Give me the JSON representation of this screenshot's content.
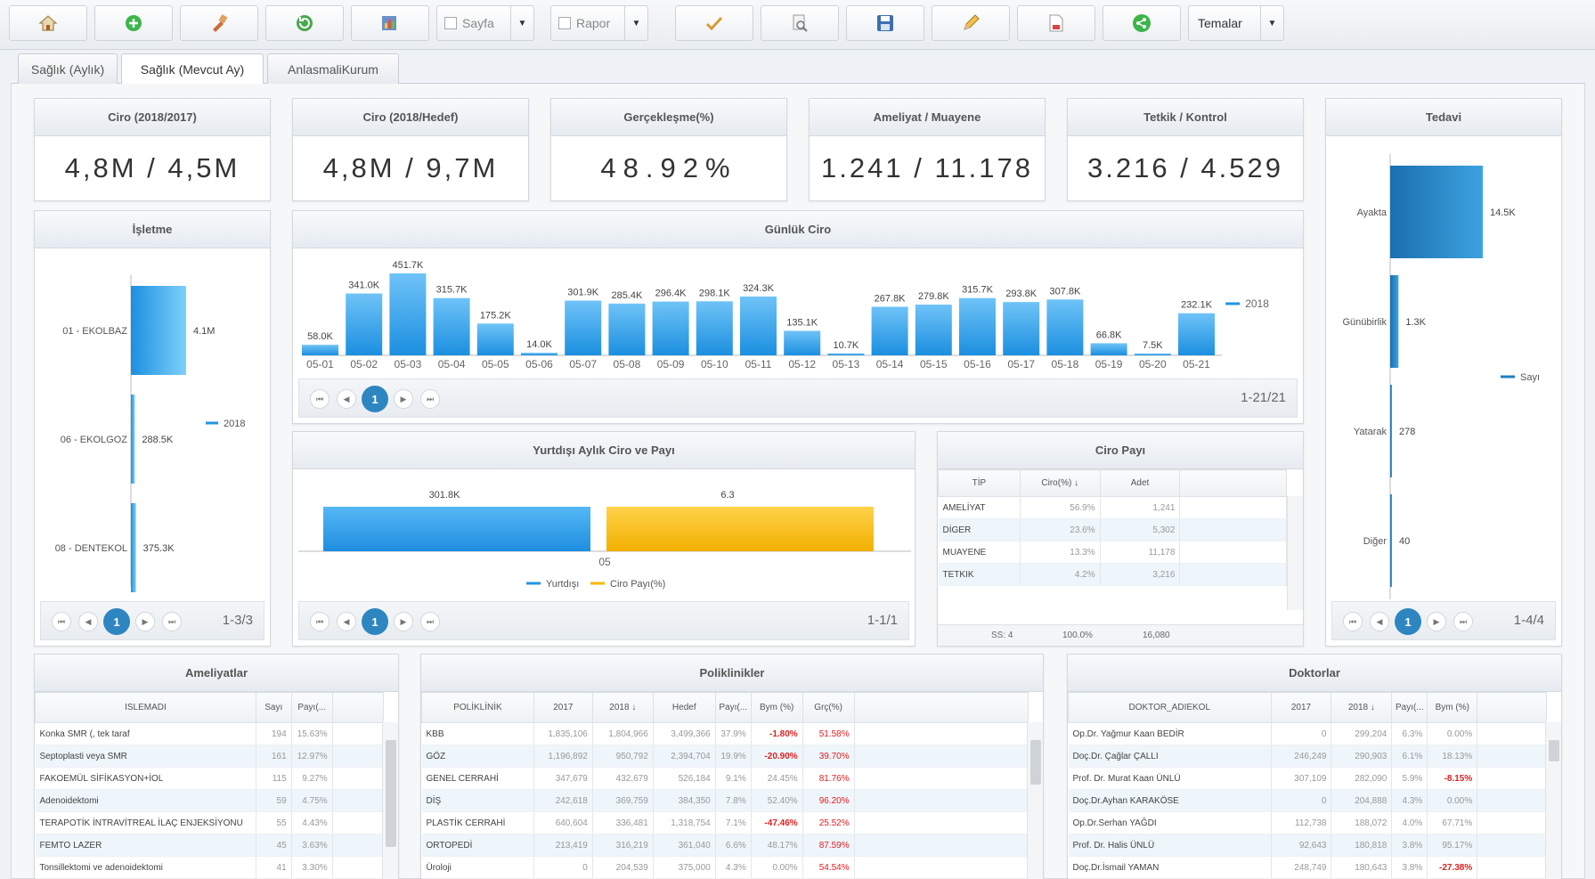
{
  "toolbar": {
    "buttons": [
      "home-icon",
      "add-icon",
      "tools-icon",
      "refresh-icon",
      "report-icon",
      "approve-icon",
      "search-doc-icon",
      "save-icon",
      "edit-icon",
      "pdf-icon",
      "share-icon"
    ],
    "sayfa_label": "Sayfa",
    "rapor_label": "Rapor",
    "temalar_label": "Temalar"
  },
  "tabs": [
    "Sağlık (Aylık)",
    "Sağlık (Mevcut Ay)",
    "AnlasmaliKurum"
  ],
  "kpis": [
    {
      "title": "Ciro (2018/2017)",
      "value": "4,8M / 4,5M"
    },
    {
      "title": "Ciro (2018/Hedef)",
      "value": "4,8M / 9,7M"
    },
    {
      "title": "Gerçekleşme(%)",
      "value": "48.92%"
    },
    {
      "title": "Ameliyat / Muayene",
      "value": "1.241 / 11.178"
    },
    {
      "title": "Tetkik / Kontrol",
      "value": "3.216 / 4.529"
    }
  ],
  "tedavi": {
    "title": "Tedavi",
    "pager": "1-4/4",
    "page": "1"
  },
  "isletme": {
    "title": "İşletme",
    "pager": "1-3/3",
    "page": "1"
  },
  "gunluk": {
    "title": "Günlük Ciro",
    "pager": "1-21/21",
    "page": "1"
  },
  "yurtdisi": {
    "title": "Yurtdışı Aylık Ciro ve Payı",
    "pager": "1-1/1",
    "page": "1"
  },
  "ciro_payi": {
    "title": "Ciro Payı",
    "columns": [
      "TİP",
      "Ciro(%) ↓",
      "Adet"
    ],
    "rows": [
      [
        "AMELİYAT",
        "56.9%",
        "1,241"
      ],
      [
        "DİGER",
        "23.6%",
        "5,302"
      ],
      [
        "MUAYENE",
        "13.3%",
        "11,178"
      ],
      [
        "TETKIK",
        "4.2%",
        "3,216"
      ]
    ],
    "footer": [
      "SS: 4",
      "100.0%",
      "16,080"
    ]
  },
  "ameliyatlar": {
    "title": "Ameliyatlar",
    "columns": [
      "ISLEMADI",
      "Sayı",
      "Payı(..."
    ],
    "rows": [
      [
        "Konka SMR (, tek taraf",
        "194",
        "15.63%"
      ],
      [
        "Septoplasti veya SMR",
        "161",
        "12.97%"
      ],
      [
        "FAKOEMÜL SİFİKASYON+İOL",
        "115",
        "9.27%"
      ],
      [
        "Adenoidektomi",
        "59",
        "4.75%"
      ],
      [
        "TERAPOTİK İNTRAVİTREAL İLAÇ ENJEKSİYONU",
        "55",
        "4.43%"
      ],
      [
        "FEMTO LAZER",
        "45",
        "3.63%"
      ],
      [
        "Tonsillektomi ve adenoidektomi",
        "41",
        "3.30%"
      ]
    ]
  },
  "poliklinikler": {
    "title": "Poliklinikler",
    "columns": [
      "POLİKLİNİK",
      "2017",
      "2018 ↓",
      "Hedef",
      "Payı(...",
      "Bym (%)",
      "Grç(%)"
    ],
    "rows": [
      [
        "KBB",
        "1,835,106",
        "1,804,966",
        "3,499,366",
        "37.9%",
        "-1.80%",
        "51.58%"
      ],
      [
        "GÖZ",
        "1,196,892",
        "950,792",
        "2,394,704",
        "19.9%",
        "-20.90%",
        "39.70%"
      ],
      [
        "GENEL CERRAHİ",
        "347,679",
        "432,679",
        "526,184",
        "9.1%",
        "24.45%",
        "81.76%"
      ],
      [
        "DİŞ",
        "242,618",
        "369,759",
        "384,350",
        "7.8%",
        "52.40%",
        "96.20%"
      ],
      [
        "PLASTİK CERRAHİ",
        "640,604",
        "336,481",
        "1,318,754",
        "7.1%",
        "-47.46%",
        "25.52%"
      ],
      [
        "ORTOPEDİ",
        "213,419",
        "316,219",
        "361,040",
        "6.6%",
        "48.17%",
        "87.59%"
      ],
      [
        "Üroloji",
        "0",
        "204,539",
        "375,000",
        "4.3%",
        "0.00%",
        "54.54%"
      ]
    ]
  },
  "doktorlar": {
    "title": "Doktorlar",
    "columns": [
      "DOKTOR_ADIEKOL",
      "2017",
      "2018 ↓",
      "Payı(...",
      "Bym (%)"
    ],
    "rows": [
      [
        "Op.Dr. Yağmur Kaan BEDİR",
        "0",
        "299,204",
        "6.3%",
        "0.00%"
      ],
      [
        "Doç.Dr. Çağlar ÇALLI",
        "246,249",
        "290,903",
        "6.1%",
        "18.13%"
      ],
      [
        "Prof. Dr. Murat Kaan ÜNLÜ",
        "307,109",
        "282,090",
        "5.9%",
        "-8.15%"
      ],
      [
        "Doç.Dr.Ayhan KARAKÖSE",
        "0",
        "204,888",
        "4.3%",
        "0.00%"
      ],
      [
        "Op.Dr.Serhan YAĞDI",
        "112,738",
        "188,072",
        "4.0%",
        "67.71%"
      ],
      [
        "Prof. Dr. Halis ÜNLÜ",
        "92,643",
        "180,818",
        "3.8%",
        "95.17%"
      ],
      [
        "Doç.Dr.İsmail YAMAN",
        "248,749",
        "180,643",
        "3.8%",
        "-27.38%"
      ]
    ]
  },
  "chart_data": [
    {
      "type": "bar",
      "title": "Günlük Ciro",
      "categories": [
        "05-01",
        "05-02",
        "05-03",
        "05-04",
        "05-05",
        "05-06",
        "05-07",
        "05-08",
        "05-09",
        "05-10",
        "05-11",
        "05-12",
        "05-13",
        "05-14",
        "05-15",
        "05-16",
        "05-17",
        "05-18",
        "05-19",
        "05-20",
        "05-21"
      ],
      "values": [
        58.0,
        341.0,
        451.7,
        315.7,
        175.2,
        14.0,
        301.9,
        285.4,
        296.4,
        298.1,
        324.3,
        135.1,
        10.7,
        267.8,
        279.8,
        315.7,
        293.8,
        307.8,
        66.8,
        7.5,
        232.1
      ],
      "labels": [
        "58.0K",
        "341.0K",
        "451.7K",
        "315.7K",
        "175.2K",
        "14.0K",
        "301.9K",
        "285.4K",
        "296.4K",
        "298.1K",
        "324.3K",
        "135.1K",
        "10.7K",
        "267.8K",
        "279.8K",
        "315.7K",
        "293.8K",
        "307.8K",
        "66.8K",
        "7.5K",
        "232.1K"
      ],
      "legend": "2018",
      "color": "#2196e0"
    },
    {
      "type": "bar",
      "orientation": "horizontal",
      "title": "İşletme",
      "categories": [
        "01 - EKOLBAZ",
        "06 - EKOLGOZ",
        "08 - DENTEKOL"
      ],
      "values": [
        4100,
        288.5,
        375.3
      ],
      "labels": [
        "4.1M",
        "288.5K",
        "375.3K"
      ],
      "legend": "2018",
      "color": "#2196e0"
    },
    {
      "type": "bar",
      "orientation": "horizontal",
      "title": "Tedavi",
      "categories": [
        "Ayakta",
        "Günübirlik",
        "Yatarak",
        "Diğer"
      ],
      "values": [
        14500,
        1300,
        278,
        40
      ],
      "labels": [
        "14.5K",
        "1.3K",
        "278",
        "40"
      ],
      "legend": "Sayı",
      "color": "#1f7fc0"
    },
    {
      "type": "bar",
      "title": "Yurtdışı Aylık Ciro ve Payı",
      "categories": [
        "05"
      ],
      "series": [
        {
          "name": "Yurtdışı",
          "values": [
            301.8
          ],
          "label": "301.8K",
          "color": "#2196e0"
        },
        {
          "name": "Ciro Payı(%)",
          "values": [
            6.3
          ],
          "label": "6.3",
          "color": "#f5b800"
        }
      ]
    }
  ]
}
